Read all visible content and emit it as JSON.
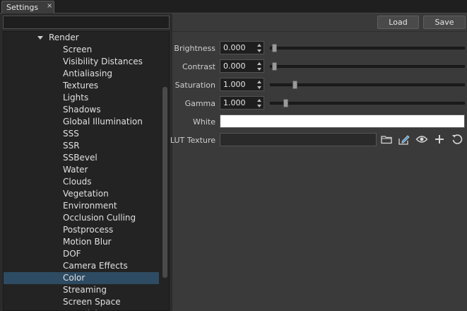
{
  "tab": {
    "title": "Settings",
    "close_glyph": "×"
  },
  "search": {
    "value": "",
    "placeholder": ""
  },
  "tree": {
    "parent": {
      "label": "Render",
      "expanded": true
    },
    "items": [
      {
        "label": "Screen"
      },
      {
        "label": "Visibility Distances"
      },
      {
        "label": "Antialiasing"
      },
      {
        "label": "Textures"
      },
      {
        "label": "Lights"
      },
      {
        "label": "Shadows"
      },
      {
        "label": "Global Illumination"
      },
      {
        "label": "SSS"
      },
      {
        "label": "SSR"
      },
      {
        "label": "SSBevel"
      },
      {
        "label": "Water"
      },
      {
        "label": "Clouds"
      },
      {
        "label": "Vegetation"
      },
      {
        "label": "Environment"
      },
      {
        "label": "Occlusion Culling"
      },
      {
        "label": "Postprocess"
      },
      {
        "label": "Motion Blur"
      },
      {
        "label": "DOF"
      },
      {
        "label": "Camera Effects"
      },
      {
        "label": "Color",
        "selected": true
      },
      {
        "label": "Streaming"
      },
      {
        "label": "Screen Space Materials"
      }
    ]
  },
  "toolbar": {
    "load_label": "Load",
    "save_label": "Save"
  },
  "properties": {
    "brightness": {
      "label": "Brightness",
      "value": "0.000",
      "slider_fraction": 0.0
    },
    "contrast": {
      "label": "Contrast",
      "value": "0.000",
      "slider_fraction": 0.0
    },
    "saturation": {
      "label": "Saturation",
      "value": "1.000",
      "slider_fraction": 0.11
    },
    "gamma": {
      "label": "Gamma",
      "value": "1.000",
      "slider_fraction": 0.06
    },
    "white": {
      "label": "White",
      "color": "#ffffff"
    },
    "lut_texture": {
      "label": "LUT Texture",
      "value": ""
    }
  },
  "lut_actions": [
    "folder-icon",
    "edit-icon",
    "eye-icon",
    "plus-icon",
    "reset-icon"
  ],
  "colors": {
    "selection": "#2d4b62",
    "panel": "#3a3a3a",
    "tree_bg": "#232323"
  }
}
